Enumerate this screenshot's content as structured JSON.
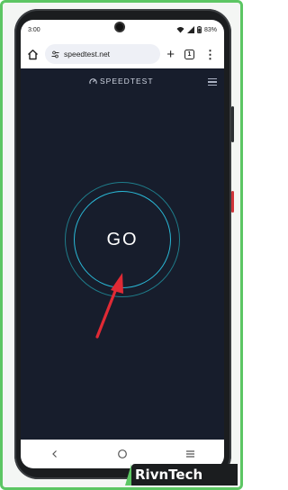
{
  "status_bar": {
    "time": "3:00",
    "battery": "83%"
  },
  "browser": {
    "url": "speedtest.net",
    "tab_count": "1"
  },
  "speedtest": {
    "logo_text": "SPEEDTEST",
    "go_label": "GO"
  },
  "watermark": {
    "part1": "Rivn",
    "part2": "Tech"
  },
  "colors": {
    "accent": "#2ab8d6",
    "background": "#171d2c",
    "arrow": "#e02a35",
    "frame": "#5cc663"
  }
}
